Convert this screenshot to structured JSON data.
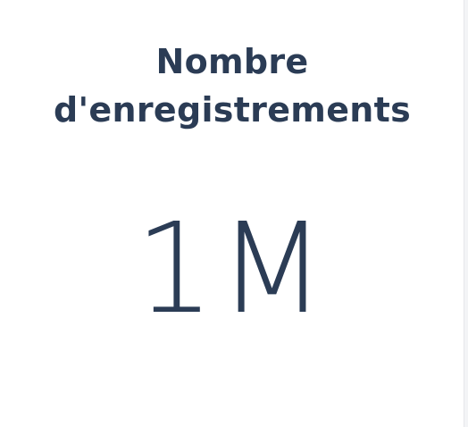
{
  "widget": {
    "title_line1": "Nombre",
    "title_line2": "d'enregistrements",
    "value": "1M"
  },
  "colors": {
    "text": "#2b3c55",
    "background": "#ffffff",
    "divider": "#e6e7ea"
  }
}
